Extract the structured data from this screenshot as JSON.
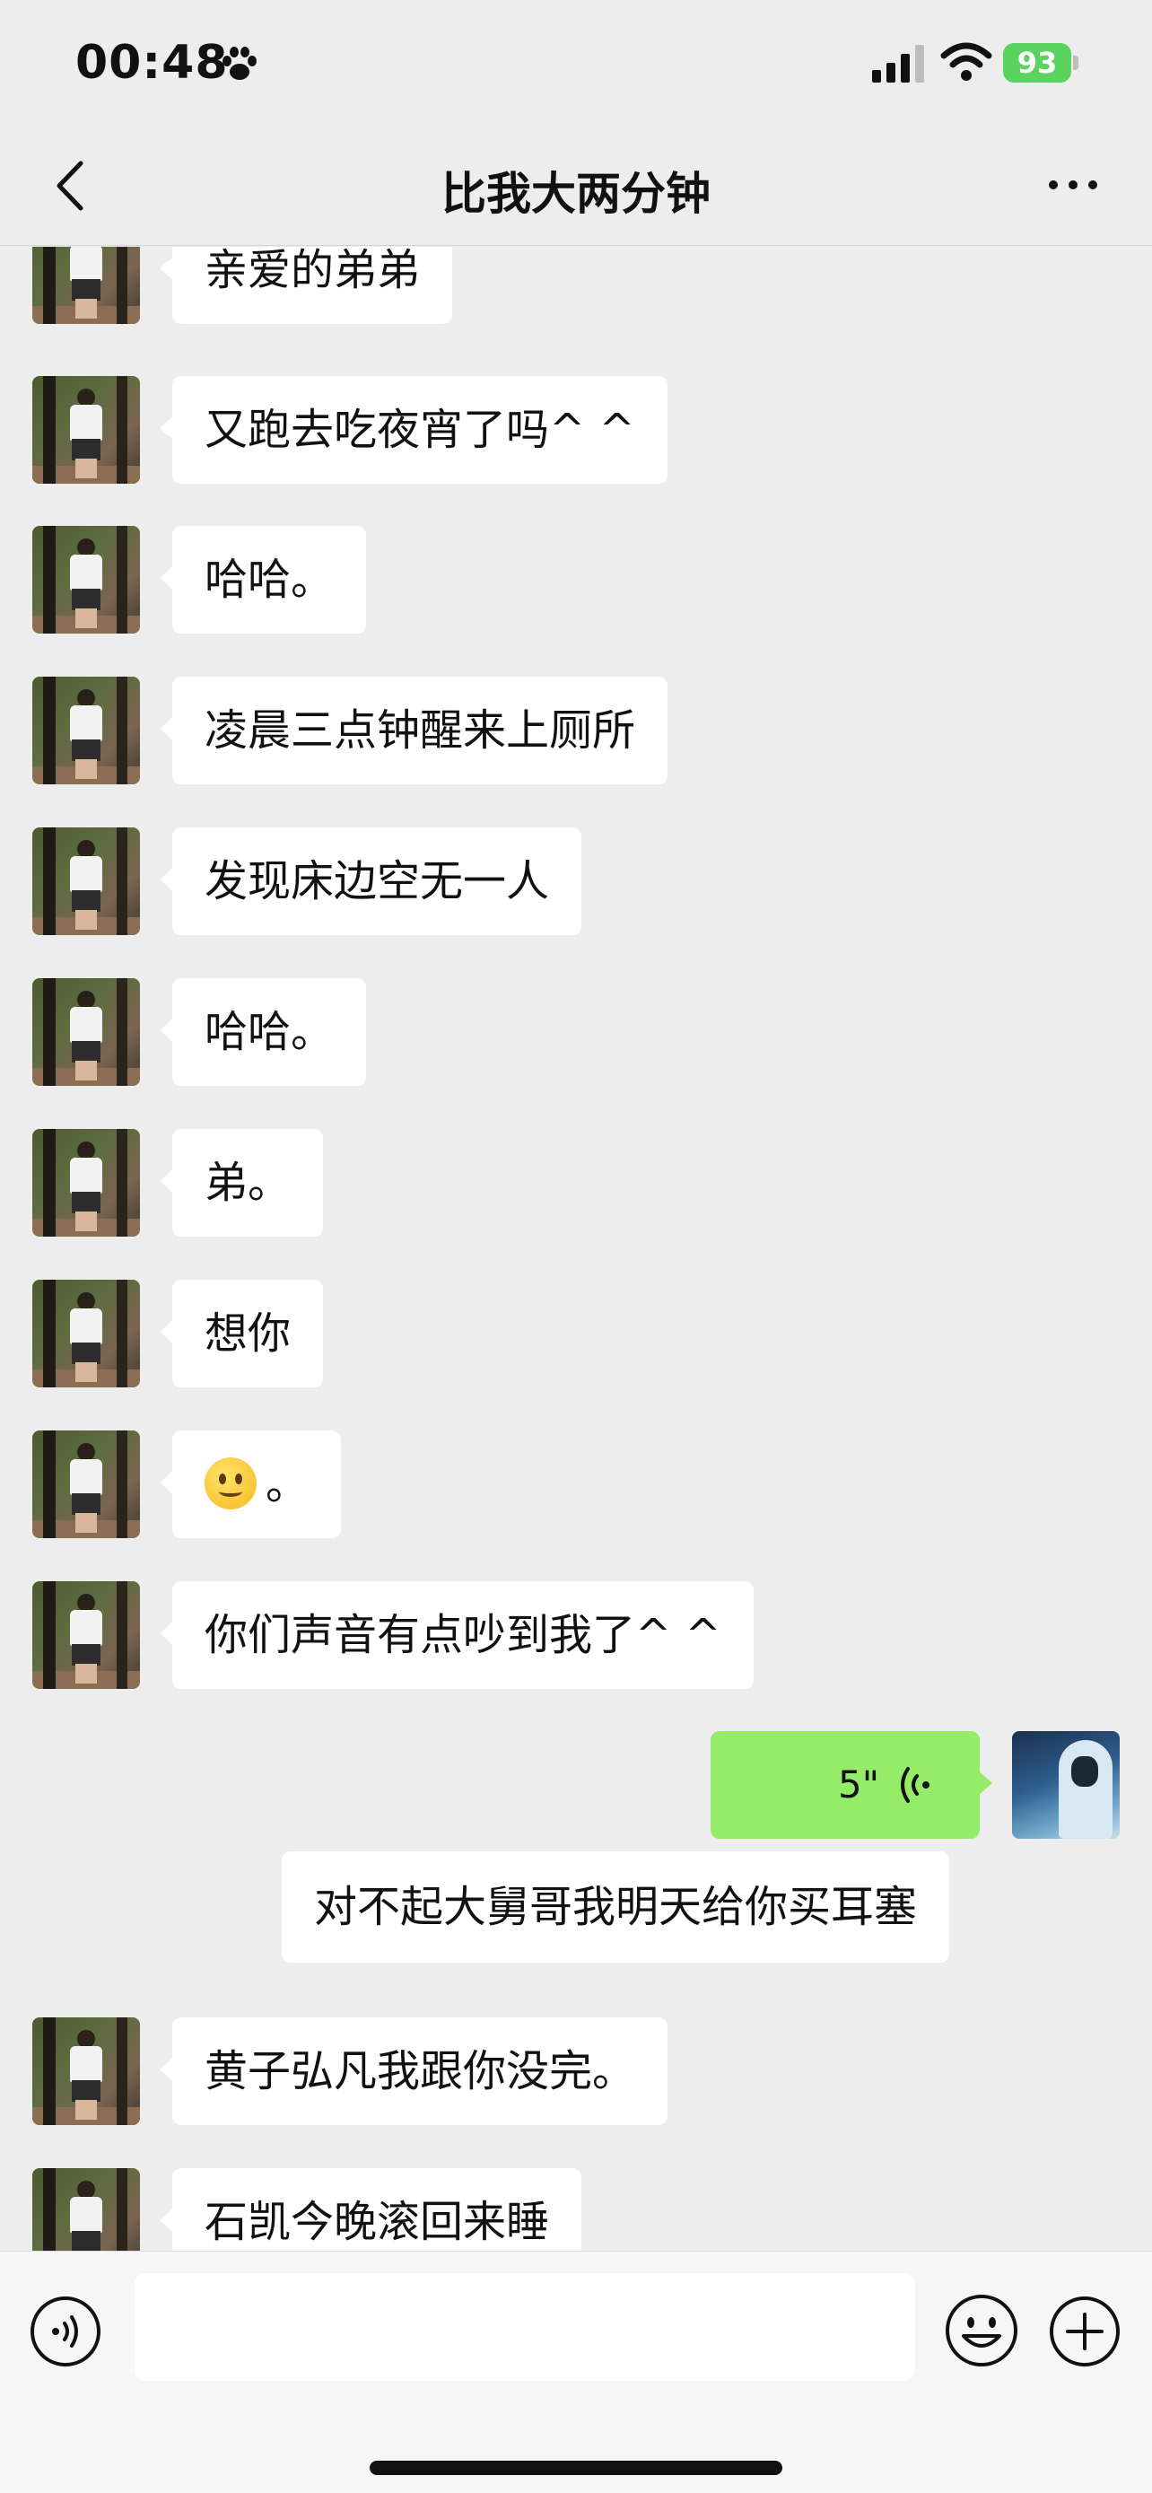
{
  "status_bar": {
    "time": "00:48",
    "battery": "93"
  },
  "nav": {
    "title": "比我大两分钟"
  },
  "messages": [
    {
      "text": "亲爱的弟弟"
    },
    {
      "text": "又跑去吃夜宵了吗^ ^"
    },
    {
      "text": "哈哈。"
    },
    {
      "text": "凌晨三点钟醒来上厕所"
    },
    {
      "text": "发现床边空无一人"
    },
    {
      "text": "哈哈。"
    },
    {
      "text": "弟。"
    },
    {
      "text": "想你"
    },
    {
      "text": "。",
      "emoji": "slightly-smiling-face"
    },
    {
      "text": "你们声音有点吵到我了^ ^"
    },
    {
      "text": "黄子弘凡我跟你没完。"
    },
    {
      "text": "石凯今晚滚回来睡"
    }
  ],
  "voice_message": {
    "duration": "5\""
  },
  "quote_text": "对不起大舅哥我明天给你买耳塞",
  "colors": {
    "background": "#ededed",
    "my_bubble": "#95ec69",
    "their_bubble": "#ffffff",
    "battery": "#5ad35f"
  }
}
